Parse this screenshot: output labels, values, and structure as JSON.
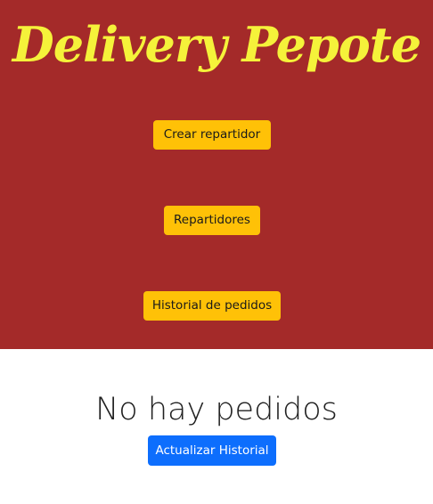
{
  "header": {
    "brand_title": "Delivery Pepote",
    "nav": {
      "create_courier_label": "Crear repartidor",
      "couriers_label": "Repartidores",
      "order_history_label": "Historial de pedidos"
    }
  },
  "main": {
    "empty_message": "No hay pedidos",
    "refresh_label": "Actualizar Historial"
  },
  "colors": {
    "header_bg": "#a42a29",
    "brand_text": "#f5f23a",
    "nav_button_bg": "#ffc107",
    "primary_button_bg": "#0d6efd",
    "page_bg": "#ffffff"
  }
}
